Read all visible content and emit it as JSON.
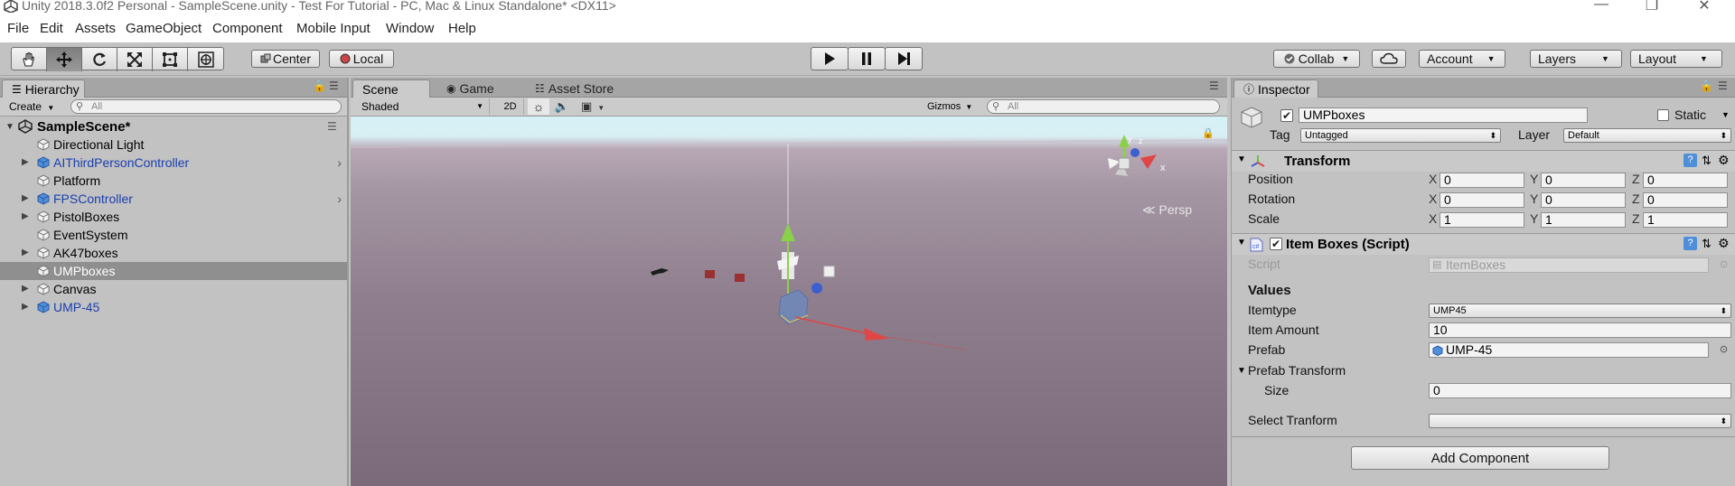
{
  "window": {
    "title": "Unity 2018.3.0f2 Personal - SampleScene.unity - Test For Tutorial - PC, Mac & Linux Standalone* <DX11>"
  },
  "menu": [
    "File",
    "Edit",
    "Assets",
    "GameObject",
    "Component",
    "Mobile Input",
    "Window",
    "Help"
  ],
  "toolbar": {
    "pivot_label": "Center",
    "space_label": "Local",
    "collab_label": "Collab",
    "account_label": "Account",
    "layers_label": "Layers",
    "layout_label": "Layout"
  },
  "hierarchy": {
    "tab_label": "Hierarchy",
    "create_label": "Create",
    "search_placeholder": "All",
    "scene_name": "SampleScene*",
    "items": [
      {
        "label": "Directional Light",
        "prefab": false,
        "expandable": false,
        "selected": false
      },
      {
        "label": "AIThirdPersonController",
        "prefab": true,
        "expandable": true,
        "selected": false
      },
      {
        "label": "Platform",
        "prefab": false,
        "expandable": false,
        "selected": false
      },
      {
        "label": "FPSController",
        "prefab": true,
        "expandable": true,
        "selected": false
      },
      {
        "label": "PistolBoxes",
        "prefab": false,
        "expandable": true,
        "selected": false
      },
      {
        "label": "EventSystem",
        "prefab": false,
        "expandable": false,
        "selected": false
      },
      {
        "label": "AK47boxes",
        "prefab": false,
        "expandable": true,
        "selected": false
      },
      {
        "label": "UMPboxes",
        "prefab": false,
        "expandable": false,
        "selected": true
      },
      {
        "label": "Canvas",
        "prefab": false,
        "expandable": true,
        "selected": false
      },
      {
        "label": "UMP-45",
        "prefab": true,
        "expandable": true,
        "selected": false
      }
    ]
  },
  "scene_view": {
    "tabs": [
      "Scene",
      "Game",
      "Asset Store"
    ],
    "shading_mode": "Shaded",
    "mode_2d": "2D",
    "gizmos_label": "Gizmos",
    "search_placeholder": "All",
    "persp_label": "Persp",
    "gizmo_axes": {
      "x": "x",
      "y": "y",
      "z": "z"
    }
  },
  "inspector": {
    "tab_label": "Inspector",
    "object_name": "UMPboxes",
    "static_label": "Static",
    "tag_label": "Tag",
    "tag_value": "Untagged",
    "layer_label": "Layer",
    "layer_value": "Default",
    "transform": {
      "title": "Transform",
      "rows": [
        {
          "label": "Position",
          "x": "0",
          "y": "0",
          "z": "0"
        },
        {
          "label": "Rotation",
          "x": "0",
          "y": "0",
          "z": "0"
        },
        {
          "label": "Scale",
          "x": "1",
          "y": "1",
          "z": "1"
        }
      ]
    },
    "script_component": {
      "title": "Item Boxes (Script)",
      "script_label": "Script",
      "script_value": "ItemBoxes",
      "values_header": "Values",
      "itemtype_label": "Itemtype",
      "itemtype_value": "UMP45",
      "amount_label": "Item Amount",
      "amount_value": "10",
      "prefab_label": "Prefab",
      "prefab_value": "UMP-45",
      "prefab_transform_label": "Prefab Transform",
      "size_label": "Size",
      "size_value": "0",
      "select_label": "Select Tranform",
      "select_value": ""
    },
    "add_component_label": "Add Component"
  }
}
